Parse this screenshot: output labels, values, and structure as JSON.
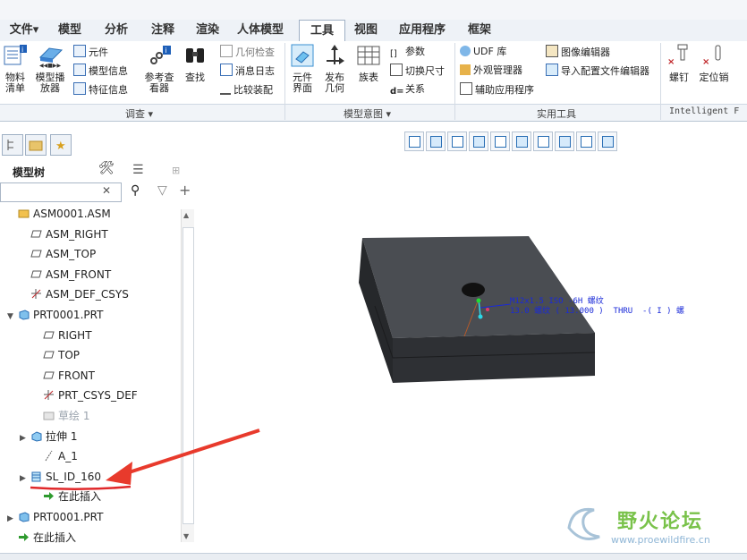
{
  "menu": {
    "file_menu": "文件▾",
    "tabs": [
      "模型",
      "分析",
      "注释",
      "渲染",
      "人体模型",
      "工具",
      "视图",
      "应用程序",
      "框架"
    ],
    "active_tab": "工具"
  },
  "ribbon": {
    "investigate": {
      "wuliao": "物料\n清单",
      "player": "模型播\n放器",
      "yuanjian": "元件",
      "model_info": "模型信息",
      "feature_info": "特征信息",
      "ref_viewer": "参考查\n看器",
      "find": "查找",
      "geom_check": "几何检查",
      "msg_log": "消息日志",
      "compare": "比较装配",
      "group_label": "调查 ▾"
    },
    "model_intent": {
      "component_ui": "元件\n界面",
      "publish_geom": "发布\n几何",
      "family_table": "族表",
      "params": "参数",
      "switch_dims": "切换尺寸",
      "relations": "关系",
      "group_label": "模型意图 ▾"
    },
    "utilities": {
      "udf_lib": "UDF 库",
      "appearance_mgr": "外观管理器",
      "aux_app": "辅助应用程序",
      "image_editor": "图像编辑器",
      "config_editor": "导入配置文件编辑器",
      "group_label": "实用工具"
    },
    "intelligent": {
      "screw": "螺钉",
      "locate_pin": "定位销",
      "group_label": "Intelligent F"
    }
  },
  "left_panel": {
    "title": "模型树",
    "search_placeholder": "",
    "tree": [
      {
        "label": "ASM0001.ASM",
        "icon": "assembly-icon",
        "indent": 0,
        "expander": ""
      },
      {
        "label": "ASM_RIGHT",
        "icon": "datum-plane-icon",
        "indent": 1,
        "expander": ""
      },
      {
        "label": "ASM_TOP",
        "icon": "datum-plane-icon",
        "indent": 1,
        "expander": ""
      },
      {
        "label": "ASM_FRONT",
        "icon": "datum-plane-icon",
        "indent": 1,
        "expander": ""
      },
      {
        "label": "ASM_DEF_CSYS",
        "icon": "csys-icon",
        "indent": 1,
        "expander": ""
      },
      {
        "label": "PRT0001.PRT",
        "icon": "part-icon",
        "indent": 0,
        "expander": "▼"
      },
      {
        "label": "RIGHT",
        "icon": "datum-plane-icon",
        "indent": 2,
        "expander": ""
      },
      {
        "label": "TOP",
        "icon": "datum-plane-icon",
        "indent": 2,
        "expander": ""
      },
      {
        "label": "FRONT",
        "icon": "datum-plane-icon",
        "indent": 2,
        "expander": ""
      },
      {
        "label": "PRT_CSYS_DEF",
        "icon": "csys-icon",
        "indent": 2,
        "expander": ""
      },
      {
        "label": "草绘 1",
        "icon": "sketch-icon",
        "indent": 2,
        "expander": "",
        "dim": true
      },
      {
        "label": "拉伸 1",
        "icon": "extrude-icon",
        "indent": 1,
        "expander": "▶"
      },
      {
        "label": "A_1",
        "icon": "axis-icon",
        "indent": 2,
        "expander": ""
      },
      {
        "label": "SL_ID_160",
        "icon": "thread-icon",
        "indent": 1,
        "expander": "▶"
      },
      {
        "label": "在此插入",
        "icon": "insert-arrow-icon",
        "indent": 2,
        "expander": ""
      },
      {
        "label": "PRT0001.PRT",
        "icon": "part-icon",
        "indent": 0,
        "expander": "▶"
      },
      {
        "label": "在此插入",
        "icon": "insert-arrow-icon",
        "indent": 0,
        "expander": ""
      }
    ]
  },
  "graphics": {
    "annotation_line1": "M12x1.5 ISO -6H 螺纹",
    "annotation_line2": "13.0 螺纹 ( 13.000 )  THRU  -( I ) 螺"
  },
  "watermark": {
    "title": "野火论坛",
    "url": "www.proewildfire.cn"
  },
  "colors": {
    "accent": "#2a6fd1",
    "annotation": "#1a2ad8",
    "arrow": "#e83a2c",
    "underline": "#e0282a",
    "model_top": "#4a4d52",
    "model_side": "#2c2e32"
  }
}
